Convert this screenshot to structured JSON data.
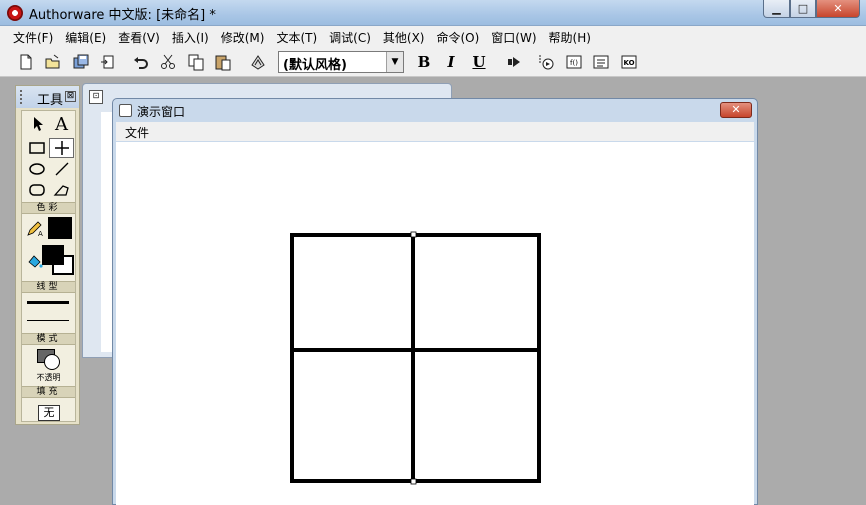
{
  "app": {
    "title": "Authorware 中文版: [未命名] *",
    "window_buttons": {
      "minimize": "▁",
      "maximize": "□",
      "close": "✕"
    }
  },
  "menubar": {
    "items": [
      "文件(F)",
      "编辑(E)",
      "查看(V)",
      "插入(I)",
      "修改(M)",
      "文本(T)",
      "调试(C)",
      "其他(X)",
      "命令(O)",
      "窗口(W)",
      "帮助(H)"
    ]
  },
  "toolbar": {
    "style_select": {
      "value": "(默认风格)"
    },
    "format": {
      "bold": "B",
      "italic": "I",
      "underline": "U"
    },
    "icons": [
      "new-icon",
      "open-icon",
      "save-all-icon",
      "import-icon",
      "undo-icon",
      "cut-icon",
      "copy-icon",
      "paste-icon",
      "find-icon",
      "run-icon",
      "control-panel-icon",
      "functions-icon",
      "variables-icon",
      "knowledge-objects-icon"
    ]
  },
  "tools_palette": {
    "title": "工具",
    "close": "⊠",
    "sections": {
      "color": "色彩",
      "line": "线型",
      "mode": "模式",
      "fill": "填充"
    },
    "mode_label": "不透明",
    "fill_label": "无",
    "text_tool_label": "A"
  },
  "flowchart_window": {
    "icon": "⊡"
  },
  "presentation_window": {
    "title": "演示窗口",
    "close": "✕",
    "menu": [
      "文件"
    ],
    "drawing": {
      "stroke": "#000000",
      "grid": "2x2"
    }
  }
}
